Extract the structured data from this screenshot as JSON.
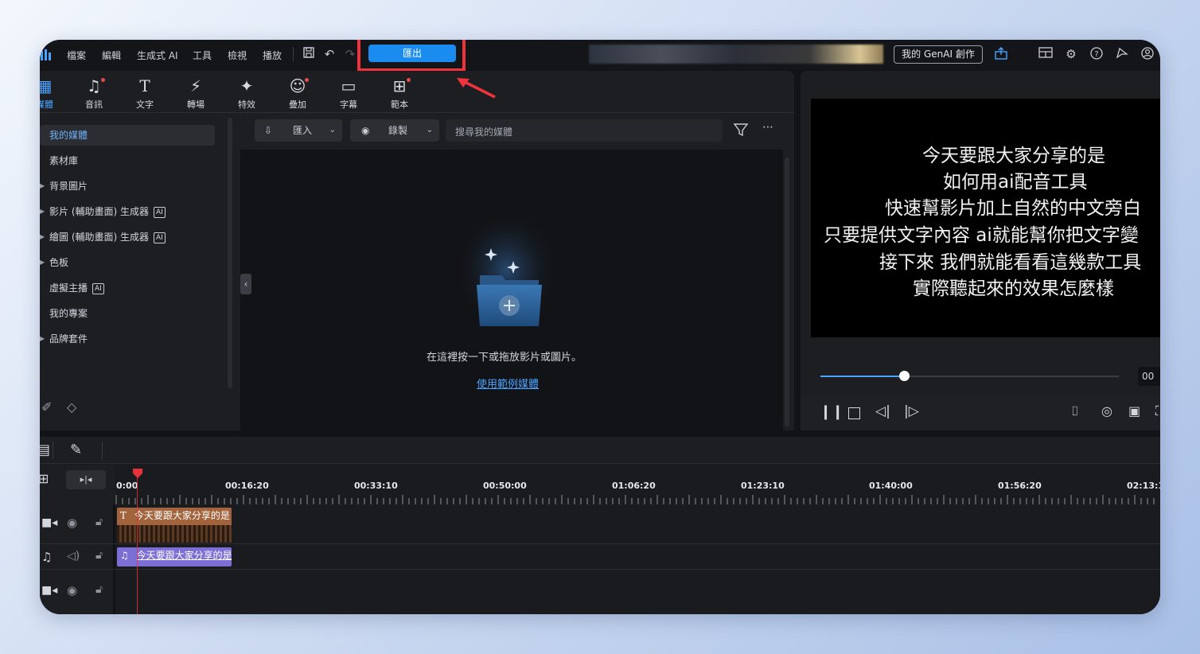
{
  "menu": {
    "items": [
      "檔案",
      "編輯",
      "生成式 AI",
      "工具",
      "檢視",
      "播放"
    ],
    "export_label": "匯出",
    "genai_label": "我的 GenAI 創作"
  },
  "toolbar": {
    "tools": [
      {
        "label": "媒體",
        "icon": "media-icon"
      },
      {
        "label": "音訊",
        "icon": "music-icon",
        "dot": true
      },
      {
        "label": "文字",
        "icon": "text-icon"
      },
      {
        "label": "轉場",
        "icon": "transition-icon"
      },
      {
        "label": "特效",
        "icon": "effects-icon"
      },
      {
        "label": "疊加",
        "icon": "overlay-icon",
        "dot": true
      },
      {
        "label": "字幕",
        "icon": "subtitle-icon"
      },
      {
        "label": "範本",
        "icon": "template-icon",
        "dot": true
      }
    ]
  },
  "sidebar": {
    "items": [
      {
        "label": "我的媒體",
        "active": true
      },
      {
        "label": "素材庫"
      },
      {
        "label": "背景圖片",
        "expandable": true
      },
      {
        "label": "影片 (輔助畫面) 生成器",
        "expandable": true,
        "ai": true
      },
      {
        "label": "繪圖 (輔助畫面) 生成器",
        "expandable": true,
        "ai": true
      },
      {
        "label": "色板",
        "expandable": true
      },
      {
        "label": "虛擬主播",
        "ai": true
      },
      {
        "label": "我的專案"
      },
      {
        "label": "品牌套件",
        "expandable": true
      }
    ],
    "ai_badge": "AI"
  },
  "media": {
    "import_label": "匯入",
    "record_label": "錄製",
    "search_placeholder": "搜尋我的媒體",
    "drop_hint": "在這裡按一下或拖放影片或圖片。",
    "sample_link": "使用範例媒體"
  },
  "preview": {
    "subtitle_lines": [
      "今天要跟大家分享的是",
      "如何用ai配音工具",
      "快速幫影片加上自然的中文旁白",
      "只要提供文字內容 ai就能幫你把文字變",
      "接下來 我們就能看看這幾款工具",
      "實際聽起來的效果怎麼樣"
    ],
    "timecode": "00",
    "progress": 0.28
  },
  "timeline": {
    "ruler": [
      "0:00",
      "00:16:20",
      "00:33:10",
      "00:50:00",
      "01:06:20",
      "01:23:10",
      "01:40:00",
      "01:56:20",
      "02:13:1"
    ],
    "text_clip_label": "今天要跟大家分享的是",
    "audio_clip_label": "今天要跟大家分享的是",
    "text_clip_icon": "T",
    "audio_clip_icon": "♫"
  },
  "colors": {
    "accent": "#1a8cf0",
    "highlight": "#f0323c",
    "text_clip": "#a2643c",
    "audio_clip": "#7b6fd6"
  }
}
